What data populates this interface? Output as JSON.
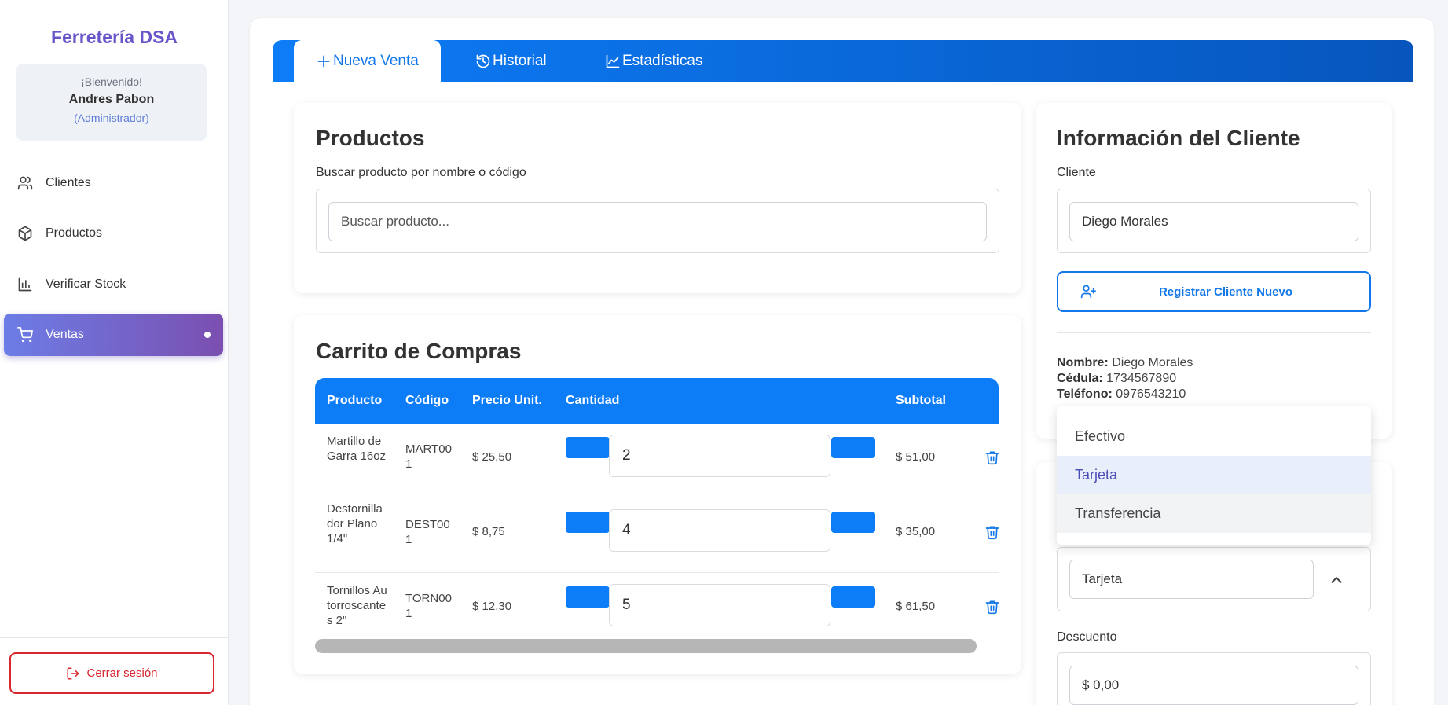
{
  "sidebar": {
    "brand": "Ferretería DSA",
    "welcome": {
      "greeting": "¡Bienvenido!",
      "user": "Andres Pabon",
      "role": "(Administrador)"
    },
    "items": [
      {
        "label": "Clientes",
        "icon": "users-icon"
      },
      {
        "label": "Productos",
        "icon": "box-icon"
      },
      {
        "label": "Verificar Stock",
        "icon": "bar-chart-icon"
      },
      {
        "label": "Ventas",
        "icon": "cart-icon",
        "active": true
      }
    ],
    "logout": "Cerrar sesión"
  },
  "tabs": [
    {
      "label": "Nueva Venta",
      "icon": "plus-icon",
      "active": true
    },
    {
      "label": "Historial",
      "icon": "history-icon"
    },
    {
      "label": "Estadísticas",
      "icon": "trend-icon"
    }
  ],
  "products": {
    "title": "Productos",
    "search_label": "Buscar producto por nombre o código",
    "search_placeholder": "Buscar producto..."
  },
  "cart": {
    "title": "Carrito de Compras",
    "headers": {
      "product": "Producto",
      "code": "Código",
      "unit_price": "Precio Unit.",
      "quantity": "Cantidad",
      "subtotal": "Subtotal"
    },
    "rows": [
      {
        "product": "Martillo de Garra 16oz",
        "code": "MART001",
        "price": "$ 25,50",
        "qty": "2",
        "subtotal": "$ 51,00"
      },
      {
        "product": "Destornillador Plano 1/4\"",
        "code": "DEST001",
        "price": "$ 8,75",
        "qty": "4",
        "subtotal": "$ 35,00"
      },
      {
        "product": "Tornillos Autorroscantes 2\"",
        "code": "TORN001",
        "price": "$ 12,30",
        "qty": "5",
        "subtotal": "$ 61,50"
      }
    ]
  },
  "client": {
    "title": "Información del Cliente",
    "client_label": "Cliente",
    "client_value": "Diego Morales",
    "register_button": "Registrar Cliente Nuevo",
    "name_label": "Nombre:",
    "name_value": "Diego Morales",
    "id_label": "Cédula:",
    "id_value": "1734567890",
    "phone_label": "Teléfono:",
    "phone_value": "0976543210"
  },
  "payment": {
    "options": [
      "Efectivo",
      "Tarjeta",
      "Transferencia"
    ],
    "selected": "Tarjeta",
    "discount_label": "Descuento",
    "discount_value": "$ 0,00"
  },
  "colors": {
    "accent": "#0d7cf7",
    "brand": "#6a55c8",
    "danger": "#d9262f"
  }
}
